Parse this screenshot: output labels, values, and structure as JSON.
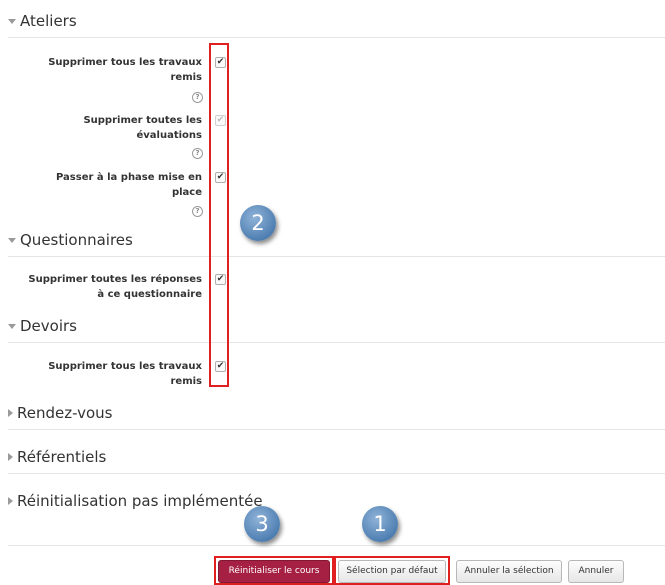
{
  "sections": {
    "ateliers": "Ateliers",
    "questionnaires": "Questionnaires",
    "devoirs": "Devoirs",
    "rendezvous": "Rendez-vous",
    "referentiels": "Référentiels",
    "reinit": "Réinitialisation pas implémentée"
  },
  "options": {
    "ateliers_delete_works": [
      "Supprimer tous les travaux",
      "remis"
    ],
    "ateliers_delete_evals": [
      "Supprimer toutes les",
      "évaluations"
    ],
    "ateliers_phase": [
      "Passer à la phase mise en",
      "place"
    ],
    "questionnaire_delete": [
      "Supprimer toutes les réponses",
      "à ce questionnaire"
    ],
    "devoirs_delete": [
      "Supprimer tous les travaux",
      "remis"
    ]
  },
  "help_glyph": "?",
  "check_glyph": "✔",
  "bubbles": {
    "b1": "1",
    "b2": "2",
    "b3": "3"
  },
  "buttons": {
    "reset": "Réinitialiser le cours",
    "default": "Sélection par défaut",
    "deselect": "Annuler la sélection",
    "cancel": "Annuler"
  },
  "colors": {
    "annotation_red": "#e02020",
    "primary_button": "#a52042",
    "bubble_blue": "#4f7fb2"
  }
}
